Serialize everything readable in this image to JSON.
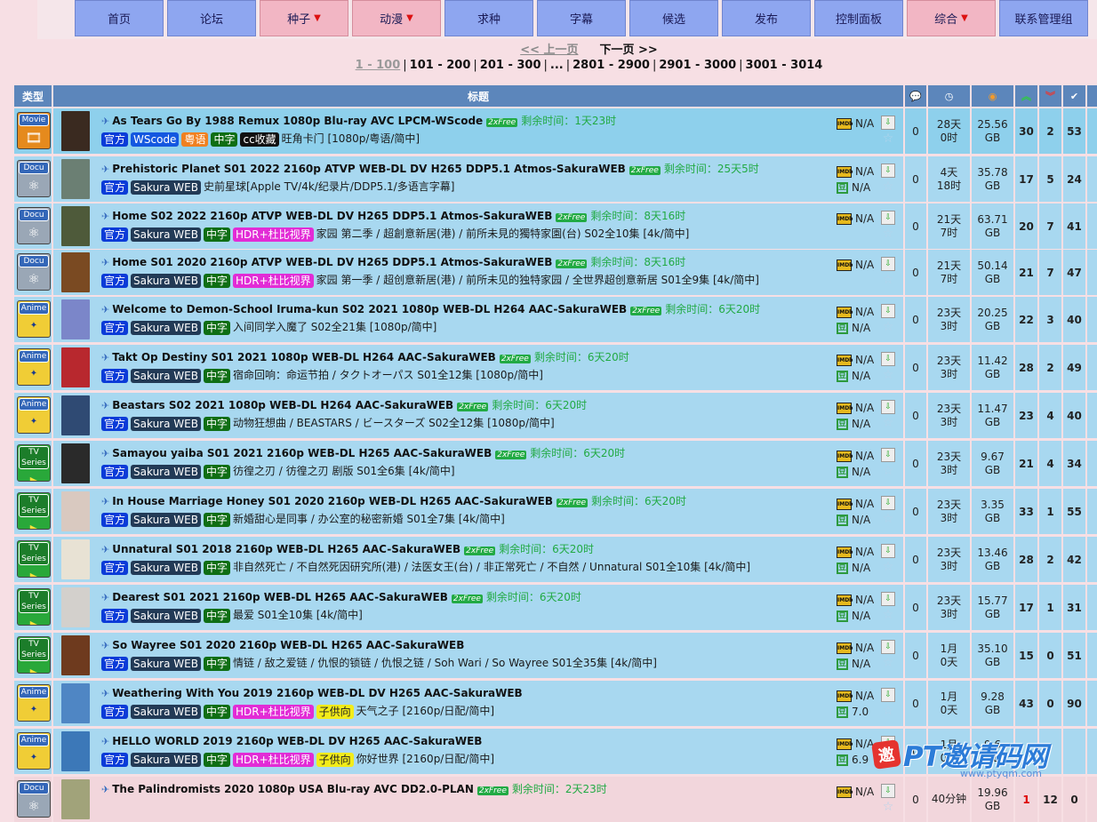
{
  "nav": {
    "items": [
      {
        "label": "首页",
        "dropdown": false
      },
      {
        "label": "论坛",
        "dropdown": false
      },
      {
        "label": "种子",
        "dropdown": true
      },
      {
        "label": "动漫",
        "dropdown": true
      },
      {
        "label": "求种",
        "dropdown": false
      },
      {
        "label": "字幕",
        "dropdown": false
      },
      {
        "label": "候选",
        "dropdown": false
      },
      {
        "label": "发布",
        "dropdown": false
      },
      {
        "label": "控制面板",
        "dropdown": false
      },
      {
        "label": "综合",
        "dropdown": true
      },
      {
        "label": "联系管理组",
        "dropdown": false
      }
    ],
    "dropdown_marker": "▼"
  },
  "pager": {
    "prev": "<< 上一页",
    "next": "下一页 >>",
    "pages": [
      "1 - 100",
      "101 - 200",
      "201 - 300",
      "...",
      "2801 - 2900",
      "2901 - 3000",
      "3001 - 3014"
    ],
    "current": "1 - 100"
  },
  "table": {
    "headers": {
      "type": "类型",
      "title": "标题"
    },
    "header_icons": [
      "comments-icon",
      "time-icon",
      "size-icon",
      "seeders-icon",
      "leechers-icon",
      "completed-icon"
    ],
    "rows": [
      {
        "category": "Movie",
        "cat_icon": "film-icon",
        "highlight": true,
        "poster": "#3a2a20",
        "title": "As Tears Go By 1988 Remux 1080p Blu-ray AVC LPCM-WScode",
        "free": "2xFree",
        "remaining": "剩余时间：1天23时",
        "tags": [
          {
            "t": "官方",
            "c": "official"
          },
          {
            "t": "WScode",
            "c": "wscode"
          },
          {
            "t": "粤语",
            "c": "yue"
          },
          {
            "t": "中字",
            "c": "zh"
          },
          {
            "t": "cc收藏",
            "c": "cc"
          }
        ],
        "subtitle": "旺角卡门 [1080p/粤语/简中]",
        "imdb": "N/A",
        "douban": "",
        "comments": "0",
        "age": [
          "28天",
          "0时"
        ],
        "size": [
          "25.56",
          "GB"
        ],
        "seeders": "30",
        "leechers": "2",
        "completed": "53",
        "leech_red": false
      },
      {
        "category": "Docu",
        "cat_icon": "atom-icon",
        "highlight": false,
        "poster": "#6b7f73",
        "title": "Prehistoric Planet S01 2022 2160p ATVP WEB-DL DV H265 DDP5.1 Atmos-SakuraWEB",
        "free": "2xFree",
        "remaining": "剩余时间：25天5时",
        "tags": [
          {
            "t": "官方",
            "c": "official"
          },
          {
            "t": "Sakura WEB",
            "c": "sakura"
          }
        ],
        "subtitle": "史前星球[Apple TV/4k/纪录片/DDP5.1/多语言字幕]",
        "imdb": "N/A",
        "douban": "N/A",
        "comments": "0",
        "age": [
          "4天",
          "18时"
        ],
        "size": [
          "35.78",
          "GB"
        ],
        "seeders": "17",
        "leechers": "5",
        "completed": "24",
        "leech_red": false
      },
      {
        "category": "Docu",
        "cat_icon": "atom-icon",
        "highlight": false,
        "poster": "#4e5a3a",
        "title": "Home S02 2022 2160p ATVP WEB-DL DV H265 DDP5.1 Atmos-SakuraWEB",
        "free": "2xFree",
        "remaining": "剩余时间：8天16时",
        "tags": [
          {
            "t": "官方",
            "c": "official"
          },
          {
            "t": "Sakura WEB",
            "c": "sakura"
          },
          {
            "t": "中字",
            "c": "zh"
          },
          {
            "t": "HDR+杜比视界",
            "c": "hdr"
          }
        ],
        "subtitle": "家园 第二季 / 超創意新居(港) / 前所未見的獨特家園(台) S02全10集 [4k/简中]",
        "imdb": "N/A",
        "douban": "",
        "comments": "0",
        "age": [
          "21天",
          "7时"
        ],
        "size": [
          "63.71",
          "GB"
        ],
        "seeders": "20",
        "leechers": "7",
        "completed": "41",
        "leech_red": false
      },
      {
        "category": "Docu",
        "cat_icon": "atom-icon",
        "highlight": false,
        "poster": "#7a4a22",
        "title": "Home S01 2020 2160p ATVP WEB-DL DV H265 DDP5.1 Atmos-SakuraWEB",
        "free": "2xFree",
        "remaining": "剩余时间：8天16时",
        "tags": [
          {
            "t": "官方",
            "c": "official"
          },
          {
            "t": "Sakura WEB",
            "c": "sakura"
          },
          {
            "t": "中字",
            "c": "zh"
          },
          {
            "t": "HDR+杜比视界",
            "c": "hdr"
          }
        ],
        "subtitle": "家园 第一季 / 超创意新居(港) / 前所未见的独特家园 / 全世界超创意新居 S01全9集 [4k/简中]",
        "imdb": "N/A",
        "douban": "",
        "comments": "0",
        "age": [
          "21天",
          "7时"
        ],
        "size": [
          "50.14",
          "GB"
        ],
        "seeders": "21",
        "leechers": "7",
        "completed": "47",
        "leech_red": false
      },
      {
        "category": "Anime",
        "cat_icon": "disney-icon",
        "highlight": false,
        "poster": "#7b86c9",
        "title": "Welcome to Demon-School Iruma-kun S02 2021 1080p WEB-DL H264 AAC-SakuraWEB",
        "free": "2xFree",
        "remaining": "剩余时间：6天20时",
        "tags": [
          {
            "t": "官方",
            "c": "official"
          },
          {
            "t": "Sakura WEB",
            "c": "sakura"
          },
          {
            "t": "中字",
            "c": "zh"
          }
        ],
        "subtitle": "入间同学入魔了 S02全21集 [1080p/简中]",
        "imdb": "N/A",
        "douban": "N/A",
        "comments": "0",
        "age": [
          "23天",
          "3时"
        ],
        "size": [
          "20.25",
          "GB"
        ],
        "seeders": "22",
        "leechers": "3",
        "completed": "40",
        "leech_red": false
      },
      {
        "category": "Anime",
        "cat_icon": "disney-icon",
        "highlight": false,
        "poster": "#b8282e",
        "title": "Takt Op Destiny S01 2021 1080p WEB-DL H264 AAC-SakuraWEB",
        "free": "2xFree",
        "remaining": "剩余时间：6天20时",
        "tags": [
          {
            "t": "官方",
            "c": "official"
          },
          {
            "t": "Sakura WEB",
            "c": "sakura"
          },
          {
            "t": "中字",
            "c": "zh"
          }
        ],
        "subtitle": "宿命回响：命运节拍 / タクトオーパス S01全12集 [1080p/简中]",
        "imdb": "N/A",
        "douban": "N/A",
        "comments": "0",
        "age": [
          "23天",
          "3时"
        ],
        "size": [
          "11.42",
          "GB"
        ],
        "seeders": "28",
        "leechers": "2",
        "completed": "49",
        "leech_red": false
      },
      {
        "category": "Anime",
        "cat_icon": "disney-icon",
        "highlight": false,
        "poster": "#2f4a73",
        "title": "Beastars S02 2021 1080p WEB-DL H264 AAC-SakuraWEB",
        "free": "2xFree",
        "remaining": "剩余时间：6天20时",
        "tags": [
          {
            "t": "官方",
            "c": "official"
          },
          {
            "t": "Sakura WEB",
            "c": "sakura"
          },
          {
            "t": "中字",
            "c": "zh"
          }
        ],
        "subtitle": "动物狂想曲 / BEASTARS / ビースターズ S02全12集 [1080p/简中]",
        "imdb": "N/A",
        "douban": "N/A",
        "comments": "0",
        "age": [
          "23天",
          "3时"
        ],
        "size": [
          "11.47",
          "GB"
        ],
        "seeders": "23",
        "leechers": "4",
        "completed": "40",
        "leech_red": false
      },
      {
        "category": "TV Series",
        "cat_icon": "tv-icon",
        "highlight": false,
        "poster": "#2a2a2a",
        "title": "Samayou yaiba S01 2021 2160p WEB-DL H265 AAC-SakuraWEB",
        "free": "2xFree",
        "remaining": "剩余时间：6天20时",
        "tags": [
          {
            "t": "官方",
            "c": "official"
          },
          {
            "t": "Sakura WEB",
            "c": "sakura"
          },
          {
            "t": "中字",
            "c": "zh"
          }
        ],
        "subtitle": "彷徨之刃 / 彷徨之刃 剧版 S01全6集 [4k/简中]",
        "imdb": "N/A",
        "douban": "N/A",
        "comments": "0",
        "age": [
          "23天",
          "3时"
        ],
        "size": [
          "9.67",
          "GB"
        ],
        "seeders": "21",
        "leechers": "4",
        "completed": "34",
        "leech_red": false
      },
      {
        "category": "TV Series",
        "cat_icon": "tv-icon",
        "highlight": false,
        "poster": "#d9c9c0",
        "title": "In House Marriage Honey S01 2020 2160p WEB-DL H265 AAC-SakuraWEB",
        "free": "2xFree",
        "remaining": "剩余时间：6天20时",
        "tags": [
          {
            "t": "官方",
            "c": "official"
          },
          {
            "t": "Sakura WEB",
            "c": "sakura"
          },
          {
            "t": "中字",
            "c": "zh"
          }
        ],
        "subtitle": "新婚甜心是同事 / 办公室的秘密新婚 S01全7集 [4k/简中]",
        "imdb": "N/A",
        "douban": "N/A",
        "comments": "0",
        "age": [
          "23天",
          "3时"
        ],
        "size": [
          "3.35",
          "GB"
        ],
        "seeders": "33",
        "leechers": "1",
        "completed": "55",
        "leech_red": false
      },
      {
        "category": "TV Series",
        "cat_icon": "tv-icon",
        "highlight": false,
        "poster": "#e8e2d4",
        "title": "Unnatural S01 2018 2160p WEB-DL H265 AAC-SakuraWEB",
        "free": "2xFree",
        "remaining": "剩余时间：6天20时",
        "tags": [
          {
            "t": "官方",
            "c": "official"
          },
          {
            "t": "Sakura WEB",
            "c": "sakura"
          },
          {
            "t": "中字",
            "c": "zh"
          }
        ],
        "subtitle": "非自然死亡 / 不自然死因研究所(港) / 法医女王(台) / 非正常死亡 / 不自然 / Unnatural S01全10集 [4k/简中]",
        "imdb": "N/A",
        "douban": "N/A",
        "comments": "0",
        "age": [
          "23天",
          "3时"
        ],
        "size": [
          "13.46",
          "GB"
        ],
        "seeders": "28",
        "leechers": "2",
        "completed": "42",
        "leech_red": false
      },
      {
        "category": "TV Series",
        "cat_icon": "tv-icon",
        "highlight": false,
        "poster": "#d3d0cc",
        "title": "Dearest S01 2021 2160p WEB-DL H265 AAC-SakuraWEB",
        "free": "2xFree",
        "remaining": "剩余时间：6天20时",
        "tags": [
          {
            "t": "官方",
            "c": "official"
          },
          {
            "t": "Sakura WEB",
            "c": "sakura"
          },
          {
            "t": "中字",
            "c": "zh"
          }
        ],
        "subtitle": "最爱 S01全10集 [4k/简中]",
        "imdb": "N/A",
        "douban": "N/A",
        "comments": "0",
        "age": [
          "23天",
          "3时"
        ],
        "size": [
          "15.77",
          "GB"
        ],
        "seeders": "17",
        "leechers": "1",
        "completed": "31",
        "leech_red": false
      },
      {
        "category": "TV Series",
        "cat_icon": "tv-icon",
        "highlight": false,
        "poster": "#6e3a1e",
        "title": "So Wayree S01 2020 2160p WEB-DL H265 AAC-SakuraWEB",
        "free": "",
        "remaining": "",
        "tags": [
          {
            "t": "官方",
            "c": "official"
          },
          {
            "t": "Sakura WEB",
            "c": "sakura"
          },
          {
            "t": "中字",
            "c": "zh"
          }
        ],
        "subtitle": "情链 / 敌之爱链 / 仇恨的锁链 / 仇恨之链 / Soh Wari / So Wayree S01全35集 [4k/简中]",
        "imdb": "N/A",
        "douban": "N/A",
        "comments": "0",
        "age": [
          "1月",
          "0天"
        ],
        "size": [
          "35.10",
          "GB"
        ],
        "seeders": "15",
        "leechers": "0",
        "completed": "51",
        "leech_red": false
      },
      {
        "category": "Anime",
        "cat_icon": "disney-icon",
        "highlight": false,
        "poster": "#4f86c4",
        "title": "Weathering With You 2019 2160p WEB-DL DV H265 AAC-SakuraWEB",
        "free": "",
        "remaining": "",
        "tags": [
          {
            "t": "官方",
            "c": "official"
          },
          {
            "t": "Sakura WEB",
            "c": "sakura"
          },
          {
            "t": "中字",
            "c": "zh"
          },
          {
            "t": "HDR+杜比视界",
            "c": "hdr"
          },
          {
            "t": "子供向",
            "c": "kid"
          }
        ],
        "subtitle": "天气之子 [2160p/日配/简中]",
        "imdb": "N/A",
        "douban": "7.0",
        "comments": "0",
        "age": [
          "1月",
          "0天"
        ],
        "size": [
          "9.28",
          "GB"
        ],
        "seeders": "43",
        "leechers": "0",
        "completed": "90",
        "leech_red": false
      },
      {
        "category": "Anime",
        "cat_icon": "disney-icon",
        "highlight": false,
        "poster": "#3c78b8",
        "title": "HELLO WORLD 2019 2160p WEB-DL DV H265 AAC-SakuraWEB",
        "free": "",
        "remaining": "",
        "tags": [
          {
            "t": "官方",
            "c": "official"
          },
          {
            "t": "Sakura WEB",
            "c": "sakura"
          },
          {
            "t": "中字",
            "c": "zh"
          },
          {
            "t": "HDR+杜比视界",
            "c": "hdr"
          },
          {
            "t": "子供向",
            "c": "kid"
          }
        ],
        "subtitle": "你好世界 [2160p/日配/简中]",
        "imdb": "N/A",
        "douban": "6.9",
        "comments": "0",
        "age": [
          "1月",
          "0天"
        ],
        "size": [
          "9.6",
          "GB"
        ],
        "seeders": "",
        "leechers": "",
        "completed": "",
        "leech_red": false
      },
      {
        "category": "Docu",
        "cat_icon": "atom-icon",
        "highlight": false,
        "last": true,
        "poster": "#a1a37a",
        "title": "The Palindromists 2020 1080p USA Blu-ray AVC DD2.0-PLAN",
        "free": "2xFree",
        "remaining": "剩余时间：2天23时",
        "tags": [],
        "subtitle": "",
        "imdb": "N/A",
        "douban": "",
        "comments": "0",
        "age": [
          "40分钟",
          ""
        ],
        "size": [
          "19.96",
          "GB"
        ],
        "seeders": "1",
        "leechers": "12",
        "completed": "0",
        "leech_red": true
      }
    ]
  },
  "watermark": {
    "brand": "PT邀请码网",
    "logo_char": "邀",
    "url": "www.ptyqm.com"
  },
  "colors": {
    "nav": "#8ea6f0",
    "nav_dropdown": "#f2b6c4",
    "header": "#5c86bb",
    "row": "#a8d8f0",
    "free": "#22aa44",
    "tag_official": "#0b3bd8",
    "tag_zh": "#0f6e14",
    "tag_hdr": "#e22cd6"
  }
}
